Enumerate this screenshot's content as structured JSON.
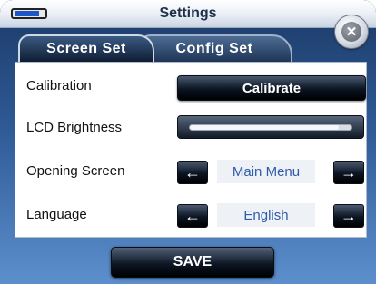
{
  "window": {
    "title": "Settings"
  },
  "status": {
    "battery_level": 0.85
  },
  "tabs": [
    {
      "label": "Screen Set",
      "active": true
    },
    {
      "label": "Config Set",
      "active": false
    }
  ],
  "settings": {
    "calibration": {
      "label": "Calibration",
      "button": "Calibrate"
    },
    "lcd_brightness": {
      "label": "LCD Brightness",
      "level": 0.92
    },
    "opening_screen": {
      "label": "Opening Screen",
      "value": "Main Menu",
      "prev_icon": "arrow-left-icon",
      "next_icon": "arrow-right-icon"
    },
    "language": {
      "label": "Language",
      "value": "English",
      "prev_icon": "arrow-left-icon",
      "next_icon": "arrow-right-icon"
    }
  },
  "footer": {
    "save_label": "SAVE"
  },
  "colors": {
    "title": "#1f2f48",
    "value_text": "#2f5caa",
    "accent": "#1b57c9"
  }
}
